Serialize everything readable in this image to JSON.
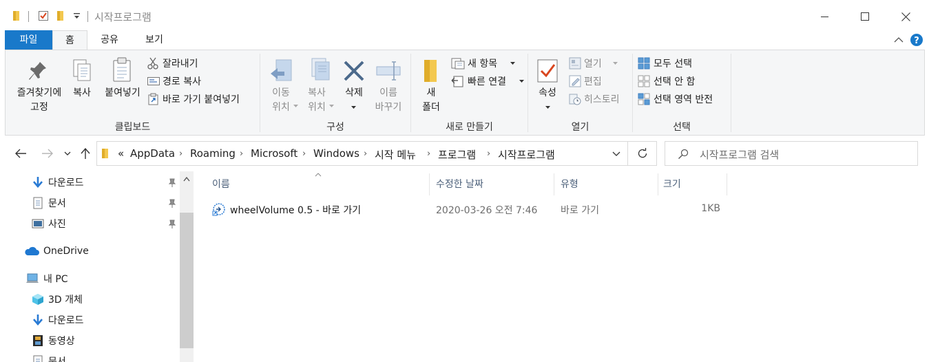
{
  "window": {
    "title": "시작프로그램"
  },
  "tabs": [
    {
      "label": "파일"
    },
    {
      "label": "홈"
    },
    {
      "label": "공유"
    },
    {
      "label": "보기"
    }
  ],
  "ribbon": {
    "clipboard": {
      "pin_label": "즐겨찾기에\n고정",
      "copy_label": "복사",
      "paste_label": "붙여넣기",
      "cut_label": "잘라내기",
      "copy_path_label": "경로 복사",
      "paste_shortcut_label": "바로 가기 붙여넣기",
      "group_title": "클립보드"
    },
    "organize": {
      "move_label": "이동\n위치",
      "copyto_label": "복사\n위치",
      "delete_label": "삭제",
      "rename_label": "이름\n바꾸기",
      "group_title": "구성"
    },
    "new": {
      "new_folder_label": "새\n폴더",
      "new_item_label": "새 항목",
      "easy_access_label": "빠른 연결",
      "group_title": "새로 만들기"
    },
    "open": {
      "properties_label": "속성",
      "open_label": "열기",
      "edit_label": "편집",
      "history_label": "히스토리",
      "group_title": "열기"
    },
    "select": {
      "select_all_label": "모두 선택",
      "select_none_label": "선택 안 함",
      "invert_label": "선택 영역 반전",
      "group_title": "선택"
    }
  },
  "address": {
    "prefix": "«",
    "crumbs": [
      "AppData",
      "Roaming",
      "Microsoft",
      "Windows",
      "시작 메뉴",
      "프로그램",
      "시작프로그램"
    ]
  },
  "search": {
    "placeholder": "시작프로그램 검색"
  },
  "nav": {
    "items": [
      {
        "label": "다운로드",
        "pinned": true
      },
      {
        "label": "문서",
        "pinned": true
      },
      {
        "label": "사진",
        "pinned": true
      },
      {
        "label": "OneDrive"
      },
      {
        "label": "내 PC"
      },
      {
        "label": "3D 개체"
      },
      {
        "label": "다운로드"
      },
      {
        "label": "동영상"
      },
      {
        "label": "문서"
      }
    ]
  },
  "columns": {
    "name": "이름",
    "modified": "수정한 날짜",
    "type": "유형",
    "size": "크기"
  },
  "files": [
    {
      "name": "wheelVolume 0.5 - 바로 가기",
      "modified": "2020-03-26 오전 7:46",
      "type": "바로 가기",
      "size": "1KB"
    }
  ],
  "colors": {
    "accent": "#1979ca",
    "folder": "#f3c84f",
    "ribbon_bg": "#f5f6f7"
  }
}
